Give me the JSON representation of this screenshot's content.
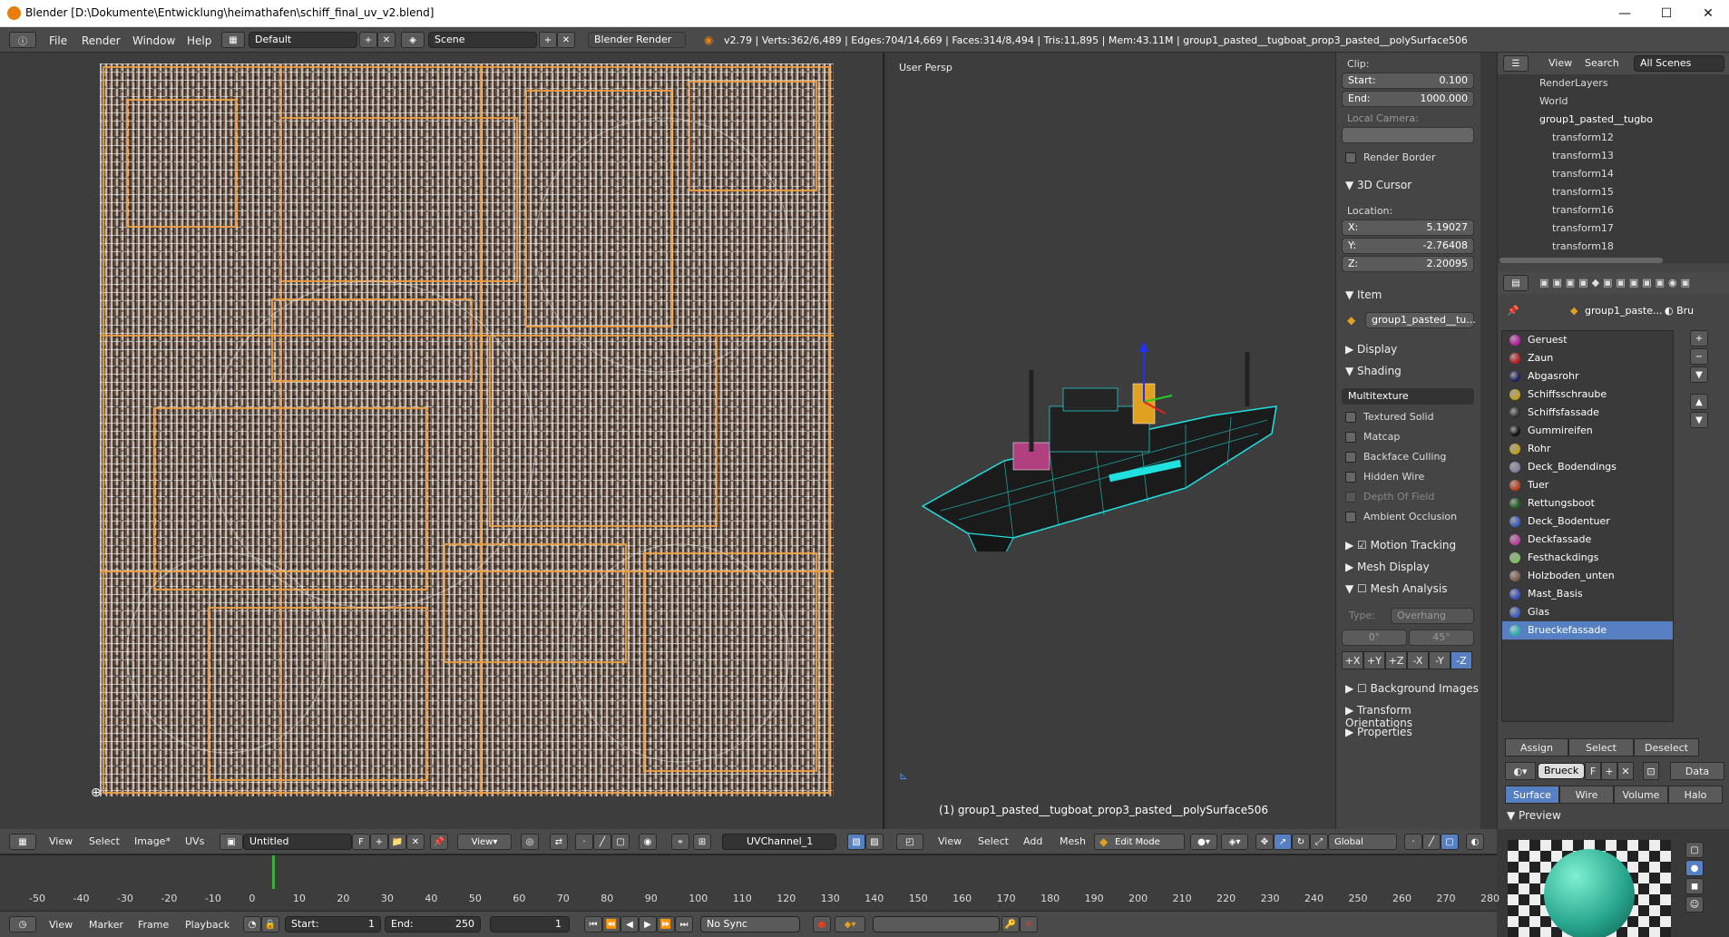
{
  "window": {
    "title": "Blender [D:\\Dokumente\\Entwicklung\\heimathafen\\schiff_final_uv_v2.blend]",
    "minimize": "—",
    "maximize": "☐",
    "close": "✕"
  },
  "infobar": {
    "menus": [
      "File",
      "Render",
      "Window",
      "Help"
    ],
    "layout": "Default",
    "scene": "Scene",
    "engine": "Blender Render",
    "stats": "v2.79 | Verts:362/6,489 | Edges:704/14,669 | Faces:314/8,494 | Tris:11,895 | Mem:43.11M | group1_pasted__tugboat_prop3_pasted__polySurface506"
  },
  "uv_editor": {
    "header_menus": [
      "View",
      "Select",
      "Image*",
      "UVs"
    ],
    "image_name": "Untitled",
    "image_flag": "F",
    "view_label": "View",
    "uv_channel": "UVChannel_1"
  },
  "view3d": {
    "label": "User Persp",
    "object_label": "(1) group1_pasted__tugboat_prop3_pasted__polySurface506",
    "header_menus": [
      "View",
      "Select",
      "Add",
      "Mesh"
    ],
    "mode": "Edit Mode",
    "orientation": "Global"
  },
  "npanel": {
    "clip_label": "Clip:",
    "start_label": "Start:",
    "start_value": "0.100",
    "end_label": "End:",
    "end_value": "1000.000",
    "local_camera_label": "Local Camera:",
    "render_border": "Render Border",
    "cursor_section": "3D Cursor",
    "location_label": "Location:",
    "x_label": "X:",
    "x_value": "5.19027",
    "y_label": "Y:",
    "y_value": "-2.76408",
    "z_label": "Z:",
    "z_value": "2.20095",
    "item_section": "Item",
    "item_name": "group1_pasted__tu...",
    "display_section": "Display",
    "shading_section": "Shading",
    "shading_mode": "Multitexture",
    "shading_options": [
      "Textured Solid",
      "Matcap",
      "Backface Culling",
      "Hidden Wire",
      "Depth Of Field",
      "Ambient Occlusion"
    ],
    "motion_tracking": "Motion Tracking",
    "mesh_display": "Mesh Display",
    "mesh_analysis": "Mesh Analysis",
    "type_label": "Type:",
    "type_value": "Overhang",
    "angle_min": "0°",
    "angle_max": "45°",
    "axes": [
      "+X",
      "+Y",
      "+Z",
      "-X",
      "-Y",
      "-Z"
    ],
    "background_images": "Background Images",
    "transform_orientations": "Transform Orientations",
    "properties": "Properties"
  },
  "outliner": {
    "menus": [
      "View",
      "Search"
    ],
    "filter": "All Scenes",
    "items": [
      "RenderLayers",
      "World",
      "group1_pasted__tugbo",
      "transform12",
      "transform13",
      "transform14",
      "transform15",
      "transform16",
      "transform17",
      "transform18"
    ]
  },
  "properties": {
    "breadcrumb_object": "group1_paste...",
    "breadcrumb_material": "Bru",
    "materials": [
      {
        "name": "Geruest",
        "color": "#c020a0"
      },
      {
        "name": "Zaun",
        "color": "#c02020"
      },
      {
        "name": "Abgasrohr",
        "color": "#202060"
      },
      {
        "name": "Schiffsschraube",
        "color": "#c0a020"
      },
      {
        "name": "Schiffsfassade",
        "color": "#303030"
      },
      {
        "name": "Gummireifen",
        "color": "#101010"
      },
      {
        "name": "Rohr",
        "color": "#c0a020"
      },
      {
        "name": "Deck_Bodendings",
        "color": "#8080a0"
      },
      {
        "name": "Tuer",
        "color": "#c04020"
      },
      {
        "name": "Rettungsboot",
        "color": "#206020"
      },
      {
        "name": "Deck_Bodentuer",
        "color": "#4060c0"
      },
      {
        "name": "Deckfassade",
        "color": "#c040a0"
      },
      {
        "name": "Festhackdings",
        "color": "#80c060"
      },
      {
        "name": "Holzboden_unten",
        "color": "#806050"
      },
      {
        "name": "Mast_Basis",
        "color": "#4050c0"
      },
      {
        "name": "Glas",
        "color": "#4060c0"
      },
      {
        "name": "Brueckefassade",
        "color": "#30b0a0"
      }
    ],
    "assign": "Assign",
    "select": "Select",
    "deselect": "Deselect",
    "mat_name": "Brueck",
    "mat_flag": "F",
    "data": "Data",
    "tabs": [
      "Surface",
      "Wire",
      "Volume",
      "Halo"
    ],
    "preview_label": "Preview"
  },
  "timeline": {
    "menus": [
      "View",
      "Marker",
      "Frame",
      "Playback"
    ],
    "start_label": "Start:",
    "start_value": "1",
    "end_label": "End:",
    "end_value": "250",
    "current": "1",
    "sync": "No Sync",
    "ticks": [
      "-50",
      "-40",
      "-30",
      "-20",
      "-10",
      "0",
      "10",
      "20",
      "30",
      "40",
      "50",
      "60",
      "70",
      "80",
      "90",
      "100",
      "110",
      "120",
      "130",
      "140",
      "150",
      "160",
      "170",
      "180",
      "190",
      "200",
      "210",
      "220",
      "230",
      "240",
      "250",
      "260",
      "270",
      "280"
    ]
  }
}
